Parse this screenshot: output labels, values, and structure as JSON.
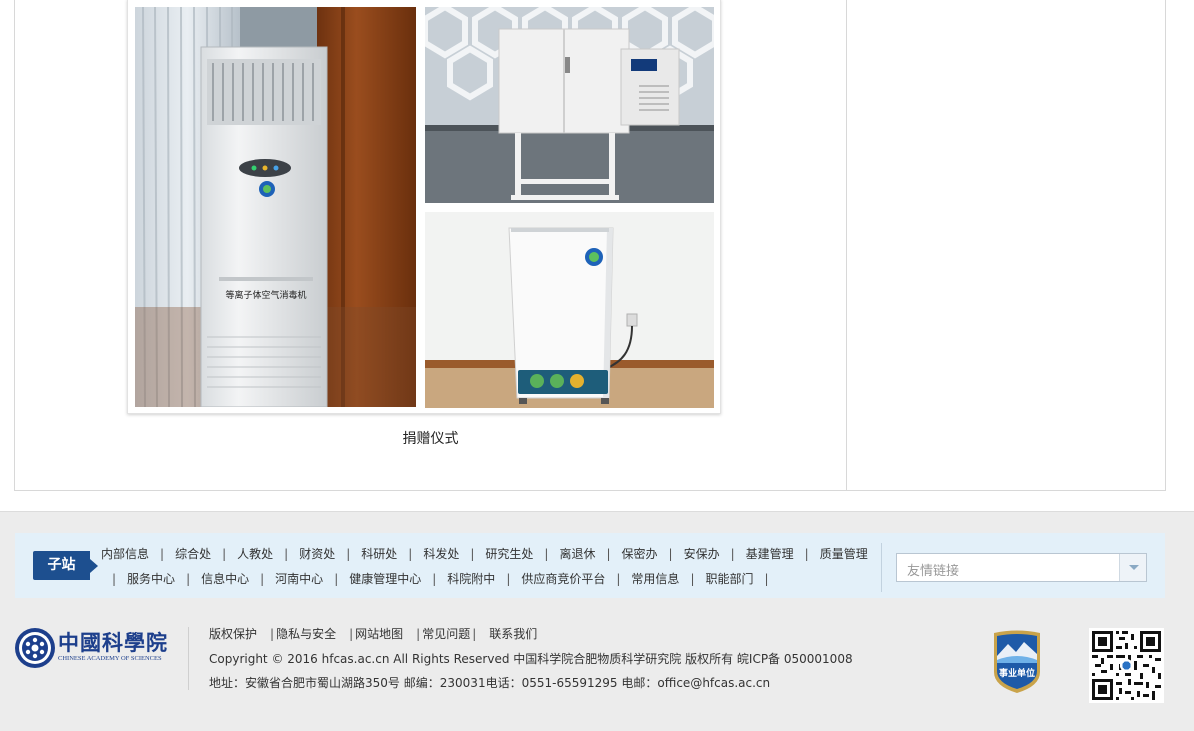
{
  "content": {
    "photos": [
      "air-disinfector-cabinet",
      "wall-mounted-sterilizer",
      "mobile-air-purifier"
    ],
    "caption": "捐赠仪式"
  },
  "footer": {
    "substations": {
      "badge": "子站",
      "links": [
        "内部信息",
        "综合处",
        "人教处",
        "财资处",
        "科研处",
        "科发处",
        "研究生处",
        "离退休",
        "保密办",
        "安保办",
        "基建管理",
        "质量管理",
        "服务中心",
        "信息中心",
        "河南中心",
        "健康管理中心",
        "科院附中",
        "供应商竞价平台",
        "常用信息",
        "职能部门"
      ],
      "friend_links_placeholder": "友情链接"
    },
    "logo": {
      "cn": "中國科學院",
      "en": "CHINESE ACADEMY OF SCIENCES"
    },
    "links": [
      "版权保护",
      "隐私与安全",
      "网站地图",
      "常见问题",
      "联系我们"
    ],
    "copyright": "Copyright © 2016 hfcas.ac.cn All Rights Reserved 中国科学院合肥物质科学研究院 版权所有 皖ICP备 050001008",
    "address": {
      "label": "地址：",
      "value": "安徽省合肥市蜀山湖路350号",
      "postcode_label": "邮编：",
      "postcode": "230031",
      "phone_label": "电话：",
      "phone": "0551-65591295",
      "email_label": "电邮：",
      "email": "office@hfcas.ac.cn"
    },
    "badge_text": "事业单位"
  },
  "colors": {
    "brand_blue": "#1d4f8f",
    "substation_bg": "#e3f0f9",
    "footer_bg": "#ececec"
  }
}
